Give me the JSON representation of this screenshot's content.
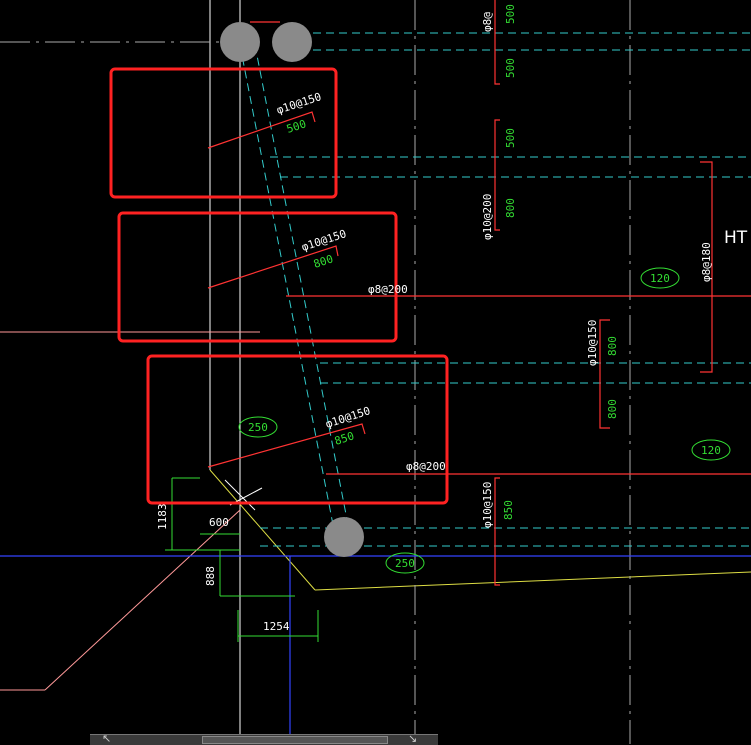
{
  "colors": {
    "background": "#000000",
    "highlight_box": "#ff2222",
    "rebar_line": "#ff3333",
    "structure_line": "#ffffff",
    "dashed_line": "#33cccc",
    "dimension": "#33dd33",
    "gray_circle": "#8a8a8a",
    "yellow_line": "#dddd44",
    "blue_line": "#3344ff"
  },
  "rebar_labels": {
    "slab_top_1": "φ10@150",
    "slab_top_1_len": "500",
    "slab_mid_1": "φ10@150",
    "slab_mid_1_len": "800",
    "slab_bot_1": "φ10@150",
    "slab_bot_1_len": "850",
    "dist_1": "φ8@200",
    "dist_2": "φ8@200",
    "right_top_rebar": "φ8@",
    "right_top_len": "500",
    "right_col1_len_a": "500",
    "right_col1_len_b": "500",
    "right_col1_rebar": "φ10@200",
    "right_col1_len_c": "800",
    "right_col2_rebar": "φ10@150",
    "right_col2_len_a": "800",
    "right_col2_len_b": "800",
    "right_col3_rebar": "φ8@180",
    "bottom_rebar": "φ10@150",
    "bottom_len": "850"
  },
  "thickness_tags": {
    "tag_250_left": "250",
    "tag_250_bottom": "250",
    "tag_120_top": "120",
    "tag_120_bottom": "120"
  },
  "dimensions": {
    "d1183": "1183",
    "d600": "600",
    "d888": "888",
    "d1254": "1254"
  },
  "edge_label": "HT",
  "status_bar": {
    "left_glyph": "↖",
    "right_glyph": "↘"
  }
}
